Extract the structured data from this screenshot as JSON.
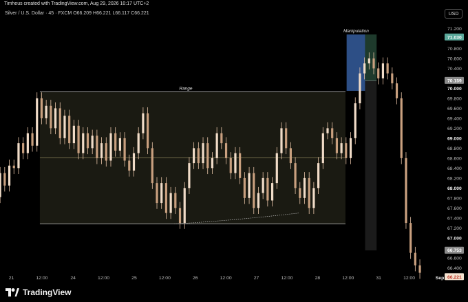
{
  "header": {
    "attribution": "Timheus created with TradingView.com, Aug 29, 2026 10:17 UTC+2"
  },
  "symbol": {
    "line": "Silver / U.S. Dollar · 45 · FXCM",
    "open": "O66.209",
    "high": "H66.221",
    "low": "L66.117",
    "close": "C66.221"
  },
  "currency_button": "USD",
  "brand": {
    "name": "TradingView"
  },
  "colors": {
    "background": "#000000",
    "candle": "#e8c4a8",
    "range_fill": "#1a1a12",
    "range_line": "#cfcfcf",
    "midline": "#c8c080",
    "manipulation_blue": "#2d4f86",
    "manipulation_green": "#1e3a2c",
    "price_tag_teal": "#5aa89a",
    "price_tag_gray": "#8a8a8a",
    "price_tag_current": "#f4e2cf",
    "price_tag_current_text": "#c0392b"
  },
  "chart_data": {
    "type": "candlestick",
    "y_axis": {
      "min": 66.28,
      "max": 71.22,
      "grid": false,
      "ticks": [
        {
          "value": 71.2,
          "label": "71.200",
          "bold": false
        },
        {
          "value": 70.8,
          "label": "70.800",
          "bold": false
        },
        {
          "value": 70.6,
          "label": "70.600",
          "bold": false
        },
        {
          "value": 70.4,
          "label": "70.400",
          "bold": false
        },
        {
          "value": 70.2,
          "label": "70.200",
          "bold": false
        },
        {
          "value": 70.0,
          "label": "70.000",
          "bold": true
        },
        {
          "value": 69.8,
          "label": "69.800",
          "bold": false
        },
        {
          "value": 69.6,
          "label": "69.600",
          "bold": false
        },
        {
          "value": 69.4,
          "label": "69.400",
          "bold": false
        },
        {
          "value": 69.2,
          "label": "69.200",
          "bold": false
        },
        {
          "value": 69.0,
          "label": "69.000",
          "bold": true
        },
        {
          "value": 68.8,
          "label": "68.800",
          "bold": false
        },
        {
          "value": 68.6,
          "label": "68.600",
          "bold": false
        },
        {
          "value": 68.4,
          "label": "68.400",
          "bold": false
        },
        {
          "value": 68.2,
          "label": "68.200",
          "bold": false
        },
        {
          "value": 68.0,
          "label": "68.000",
          "bold": true
        },
        {
          "value": 67.8,
          "label": "67.800",
          "bold": false
        },
        {
          "value": 67.6,
          "label": "67.600",
          "bold": false
        },
        {
          "value": 67.4,
          "label": "67.400",
          "bold": false
        },
        {
          "value": 67.2,
          "label": "67.200",
          "bold": false
        },
        {
          "value": 67.0,
          "label": "67.000",
          "bold": true
        },
        {
          "value": 66.6,
          "label": "66.600",
          "bold": false
        },
        {
          "value": 66.4,
          "label": "66.400",
          "bold": false
        }
      ],
      "price_tags": [
        {
          "value": 71.03,
          "label": "71.030",
          "style": "teal"
        },
        {
          "value": 70.159,
          "label": "70.159",
          "style": "gray"
        },
        {
          "value": 66.753,
          "label": "66.753",
          "style": "gray"
        },
        {
          "value": 66.221,
          "label": "66.221",
          "style": "current"
        }
      ]
    },
    "x_axis": {
      "min": 0,
      "max": 70,
      "ticks": [
        {
          "x": 0.3,
          "label": "21",
          "bold": false
        },
        {
          "x": 5.6,
          "label": "12:00",
          "bold": false
        },
        {
          "x": 11.0,
          "label": "24",
          "bold": false
        },
        {
          "x": 16.3,
          "label": "12:00",
          "bold": false
        },
        {
          "x": 21.6,
          "label": "25",
          "bold": false
        },
        {
          "x": 26.9,
          "label": "12:00",
          "bold": false
        },
        {
          "x": 32.2,
          "label": "26",
          "bold": false
        },
        {
          "x": 37.5,
          "label": "12:00",
          "bold": false
        },
        {
          "x": 42.8,
          "label": "27",
          "bold": false
        },
        {
          "x": 48.1,
          "label": "12:00",
          "bold": false
        },
        {
          "x": 53.4,
          "label": "28",
          "bold": false
        },
        {
          "x": 58.7,
          "label": "12:00",
          "bold": false
        },
        {
          "x": 64.0,
          "label": "31",
          "bold": false
        },
        {
          "x": 69.3,
          "label": "12:00",
          "bold": false
        },
        {
          "x": 74.6,
          "label": "Sep",
          "bold": true
        }
      ]
    },
    "annotations": [
      {
        "type": "range",
        "label": "Range",
        "x_start": 6.2,
        "x_end": 59.2,
        "top": 69.93,
        "bottom": 67.28,
        "mid": 68.61
      },
      {
        "type": "manipulation",
        "label": "Manipulation",
        "x_start": 59.4,
        "x_end": 64.6,
        "top": 71.08,
        "blue_bottom": 69.95,
        "green_split": 62.6,
        "green_bottom": 70.15
      },
      {
        "type": "dotted-curve",
        "points": [
          [
            29.5,
            67.28
          ],
          [
            40.0,
            67.35
          ],
          [
            51.2,
            67.5
          ]
        ]
      }
    ],
    "candles": [
      [
        -1.5,
        67.82
      ],
      [
        -0.7,
        68.3
      ],
      [
        0.1,
        68.05
      ],
      [
        0.9,
        68.45
      ],
      [
        1.7,
        68.4
      ],
      [
        2.5,
        68.9
      ],
      [
        3.3,
        68.7
      ],
      [
        4.1,
        69.1
      ],
      [
        4.9,
        68.85
      ],
      [
        5.7,
        69.8
      ],
      [
        6.5,
        69.4
      ],
      [
        7.3,
        69.65
      ],
      [
        8.1,
        69.2
      ],
      [
        8.9,
        69.6
      ],
      [
        9.7,
        69.0
      ],
      [
        10.5,
        69.45
      ],
      [
        11.3,
        68.9
      ],
      [
        12.1,
        69.25
      ],
      [
        12.9,
        68.7
      ],
      [
        13.7,
        69.1
      ],
      [
        14.5,
        68.8
      ],
      [
        15.3,
        69.05
      ],
      [
        16.1,
        68.6
      ],
      [
        16.9,
        68.9
      ],
      [
        17.7,
        68.55
      ],
      [
        18.5,
        69.1
      ],
      [
        19.3,
        68.75
      ],
      [
        20.1,
        69.0
      ],
      [
        20.9,
        68.55
      ],
      [
        21.7,
        68.35
      ],
      [
        22.5,
        68.7
      ],
      [
        23.3,
        69.1
      ],
      [
        24.1,
        69.5
      ],
      [
        24.9,
        68.8
      ],
      [
        25.7,
        68.1
      ],
      [
        26.5,
        67.7
      ],
      [
        27.3,
        68.1
      ],
      [
        28.1,
        67.5
      ],
      [
        28.9,
        67.9
      ],
      [
        29.7,
        67.6
      ],
      [
        30.5,
        67.3
      ],
      [
        31.3,
        68.0
      ],
      [
        32.1,
        68.5
      ],
      [
        32.9,
        68.8
      ],
      [
        33.7,
        68.5
      ],
      [
        34.5,
        68.9
      ],
      [
        35.3,
        68.4
      ],
      [
        36.1,
        68.6
      ],
      [
        36.9,
        69.1
      ],
      [
        37.7,
        68.9
      ],
      [
        38.5,
        68.6
      ],
      [
        39.3,
        68.3
      ],
      [
        40.1,
        68.7
      ],
      [
        40.9,
        68.2
      ],
      [
        41.7,
        67.8
      ],
      [
        42.5,
        68.3
      ],
      [
        43.3,
        67.6
      ],
      [
        44.1,
        67.9
      ],
      [
        44.9,
        68.2
      ],
      [
        45.7,
        67.75
      ],
      [
        46.5,
        68.1
      ],
      [
        47.3,
        68.7
      ],
      [
        48.1,
        69.2
      ],
      [
        48.9,
        68.8
      ],
      [
        49.7,
        68.5
      ],
      [
        50.5,
        68.0
      ],
      [
        51.3,
        67.8
      ],
      [
        52.1,
        68.2
      ],
      [
        52.9,
        67.6
      ],
      [
        53.7,
        68.0
      ],
      [
        54.5,
        68.5
      ],
      [
        55.3,
        69.1
      ],
      [
        56.1,
        69.2
      ],
      [
        56.9,
        69.0
      ],
      [
        57.7,
        68.7
      ],
      [
        58.5,
        68.9
      ],
      [
        59.3,
        68.6
      ],
      [
        60.1,
        69.0
      ],
      [
        60.9,
        69.7
      ],
      [
        61.7,
        70.3
      ],
      [
        62.5,
        70.5
      ],
      [
        63.3,
        70.6
      ],
      [
        64.1,
        70.4
      ],
      [
        64.9,
        70.2
      ],
      [
        65.7,
        70.5
      ],
      [
        66.5,
        70.3
      ],
      [
        67.3,
        70.1
      ],
      [
        68.1,
        69.8
      ],
      [
        68.9,
        68.6
      ],
      [
        69.7,
        67.3
      ],
      [
        70.5,
        66.7
      ],
      [
        71.3,
        66.45
      ],
      [
        72.1,
        66.3
      ]
    ]
  }
}
